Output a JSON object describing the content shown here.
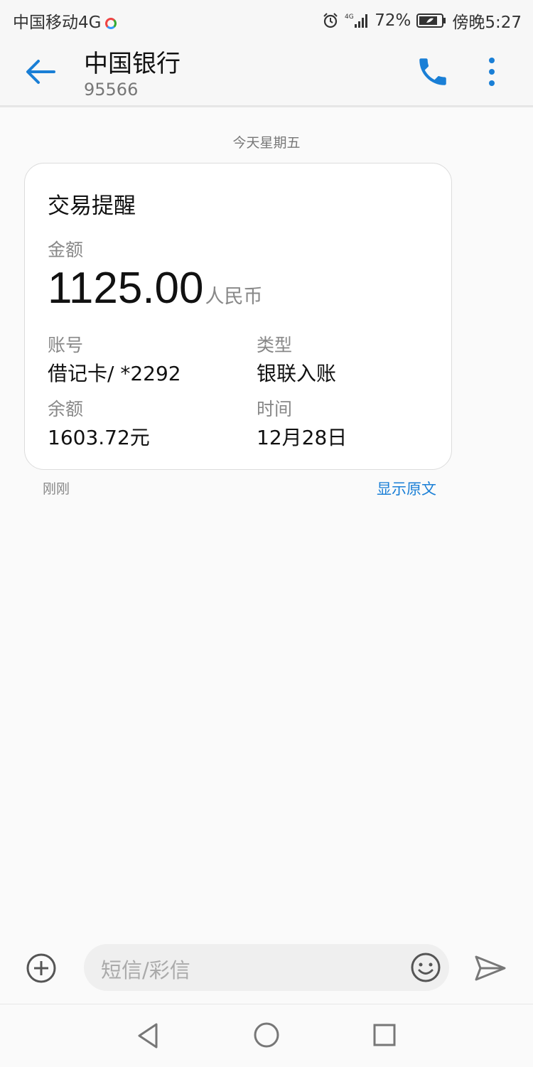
{
  "status_bar": {
    "carrier": "中国移动4G",
    "network_type": "4G",
    "battery_percent": "72%",
    "time": "傍晚5:27"
  },
  "header": {
    "title": "中国银行",
    "subtitle": "95566"
  },
  "conversation": {
    "date_divider": "今天星期五",
    "message": {
      "heading": "交易提醒",
      "amount_label": "金额",
      "amount_value": "1125.00",
      "amount_unit": "人民币",
      "fields": [
        {
          "label": "账号",
          "value": "借记卡/ *2292"
        },
        {
          "label": "类型",
          "value": "银联入账"
        },
        {
          "label": "余额",
          "value": "1603.72元"
        },
        {
          "label": "时间",
          "value": "12月28日"
        }
      ],
      "time": "刚刚",
      "show_original": "显示原文"
    }
  },
  "composer": {
    "placeholder": "短信/彩信"
  },
  "colors": {
    "accent": "#1a7fd6",
    "background": "#fafafa",
    "card": "#ffffff",
    "secondary_text": "#888888"
  },
  "icons": {
    "back": "arrow-left-icon",
    "call": "phone-icon",
    "more": "more-vertical-icon",
    "add": "plus-circle-icon",
    "emoji": "smiley-icon",
    "send": "send-icon",
    "nav_back": "triangle-back-icon",
    "nav_home": "circle-home-icon",
    "nav_recent": "square-recent-icon"
  }
}
